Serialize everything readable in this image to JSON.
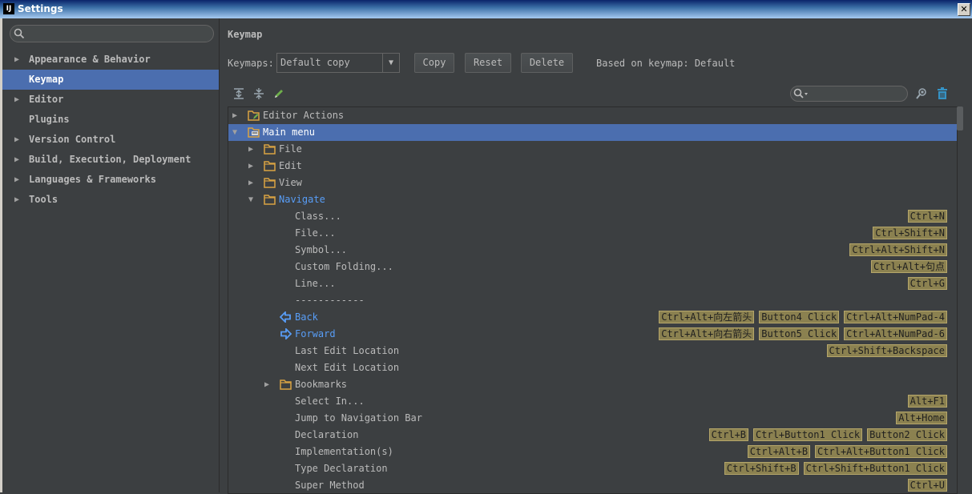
{
  "window": {
    "title": "Settings",
    "logo": "IJ",
    "close": "✕"
  },
  "sidebar": {
    "items": [
      {
        "label": "Appearance & Behavior",
        "arrow": "▶"
      },
      {
        "label": "Keymap",
        "arrow": ""
      },
      {
        "label": "Editor",
        "arrow": "▶"
      },
      {
        "label": "Plugins",
        "arrow": ""
      },
      {
        "label": "Version Control",
        "arrow": "▶"
      },
      {
        "label": "Build, Execution, Deployment",
        "arrow": "▶"
      },
      {
        "label": "Languages & Frameworks",
        "arrow": "▶"
      },
      {
        "label": "Tools",
        "arrow": "▶"
      }
    ]
  },
  "main": {
    "heading": "Keymap",
    "keymaps_label": "Keymaps:",
    "keymap_value": "Default copy",
    "copy_label": "Copy",
    "reset_label": "Reset",
    "delete_label": "Delete",
    "based_on": "Based on keymap: Default"
  },
  "tree": {
    "rows": [
      {
        "text": "Editor Actions",
        "toggle": "▶",
        "icon": "editor-actions-icon",
        "shortcuts": []
      },
      {
        "text": "Main menu",
        "toggle": "▼",
        "icon": "main-menu-icon",
        "shortcuts": []
      },
      {
        "text": "File",
        "toggle": "▶",
        "icon": "folder-icon",
        "shortcuts": []
      },
      {
        "text": "Edit",
        "toggle": "▶",
        "icon": "folder-icon",
        "shortcuts": []
      },
      {
        "text": "View",
        "toggle": "▶",
        "icon": "folder-icon",
        "shortcuts": []
      },
      {
        "text": "Navigate",
        "toggle": "▼",
        "icon": "folder-icon",
        "shortcuts": []
      },
      {
        "text": "Class...",
        "toggle": "",
        "icon": "",
        "shortcuts": [
          "Ctrl+N"
        ]
      },
      {
        "text": "File...",
        "toggle": "",
        "icon": "",
        "shortcuts": [
          "Ctrl+Shift+N"
        ]
      },
      {
        "text": "Symbol...",
        "toggle": "",
        "icon": "",
        "shortcuts": [
          "Ctrl+Alt+Shift+N"
        ]
      },
      {
        "text": "Custom Folding...",
        "toggle": "",
        "icon": "",
        "shortcuts": [
          "Ctrl+Alt+句点"
        ]
      },
      {
        "text": "Line...",
        "toggle": "",
        "icon": "",
        "shortcuts": [
          "Ctrl+G"
        ]
      },
      {
        "text": "------------",
        "toggle": "",
        "icon": "",
        "shortcuts": []
      },
      {
        "text": "Back",
        "toggle": "",
        "icon": "back-arrow-icon",
        "shortcuts": [
          "Ctrl+Alt+向左箭头",
          "Button4 Click",
          "Ctrl+Alt+NumPad-4"
        ]
      },
      {
        "text": "Forward",
        "toggle": "",
        "icon": "forward-arrow-icon",
        "shortcuts": [
          "Ctrl+Alt+向右箭头",
          "Button5 Click",
          "Ctrl+Alt+NumPad-6"
        ]
      },
      {
        "text": "Last Edit Location",
        "toggle": "",
        "icon": "",
        "shortcuts": [
          "Ctrl+Shift+Backspace"
        ]
      },
      {
        "text": "Next Edit Location",
        "toggle": "",
        "icon": "",
        "shortcuts": []
      },
      {
        "text": "Bookmarks",
        "toggle": "▶",
        "icon": "folder-icon",
        "shortcuts": []
      },
      {
        "text": "Select In...",
        "toggle": "",
        "icon": "",
        "shortcuts": [
          "Alt+F1"
        ]
      },
      {
        "text": "Jump to Navigation Bar",
        "toggle": "",
        "icon": "",
        "shortcuts": [
          "Alt+Home"
        ]
      },
      {
        "text": "Declaration",
        "toggle": "",
        "icon": "",
        "shortcuts": [
          "Ctrl+B",
          "Ctrl+Button1 Click",
          "Button2 Click"
        ]
      },
      {
        "text": "Implementation(s)",
        "toggle": "",
        "icon": "",
        "shortcuts": [
          "Ctrl+Alt+B",
          "Ctrl+Alt+Button1 Click"
        ]
      },
      {
        "text": "Type Declaration",
        "toggle": "",
        "icon": "",
        "shortcuts": [
          "Ctrl+Shift+B",
          "Ctrl+Shift+Button1 Click"
        ]
      },
      {
        "text": "Super Method",
        "toggle": "",
        "icon": "",
        "shortcuts": [
          "Ctrl+U"
        ]
      }
    ]
  },
  "colors": {
    "selection": "#4b6eaf",
    "link_blue": "#589df6",
    "shortcut_bg": "#8b8150",
    "folder": "#d9a343"
  }
}
